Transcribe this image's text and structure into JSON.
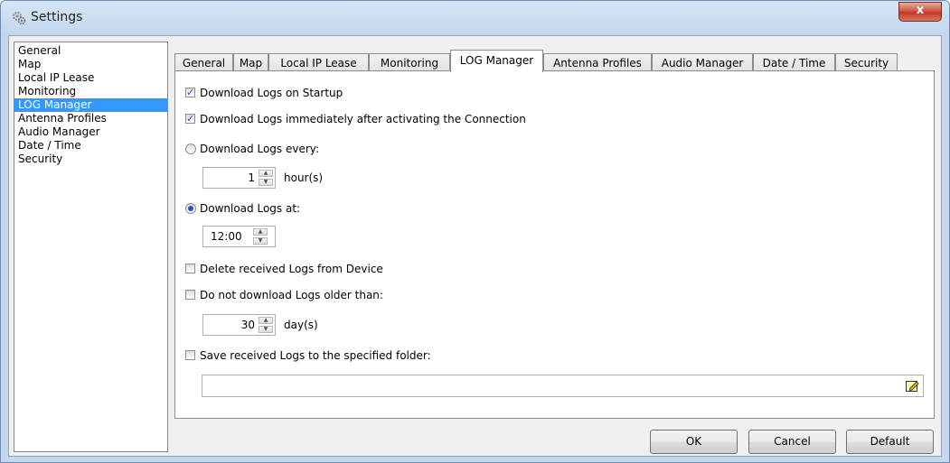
{
  "window": {
    "title": "Settings",
    "close_label": "x"
  },
  "sidebar": {
    "items": [
      {
        "label": "General"
      },
      {
        "label": "Map"
      },
      {
        "label": "Local IP Lease"
      },
      {
        "label": "Monitoring"
      },
      {
        "label": "LOG Manager",
        "selected": true
      },
      {
        "label": "Antenna Profiles"
      },
      {
        "label": "Audio Manager"
      },
      {
        "label": "Date / Time"
      },
      {
        "label": "Security"
      }
    ]
  },
  "tabs": [
    {
      "label": "General"
    },
    {
      "label": "Map"
    },
    {
      "label": "Local IP Lease"
    },
    {
      "label": "Monitoring"
    },
    {
      "label": "LOG Manager",
      "active": true
    },
    {
      "label": "Antenna Profiles"
    },
    {
      "label": "Audio Manager"
    },
    {
      "label": "Date / Time"
    },
    {
      "label": "Security"
    }
  ],
  "log_manager": {
    "download_on_startup": {
      "label": "Download Logs on Startup",
      "checked": true
    },
    "download_after_connect": {
      "label": "Download Logs immediately after activating the Connection",
      "checked": true
    },
    "download_every": {
      "label": "Download Logs every:",
      "selected": false,
      "value": "1",
      "unit": "hour(s)"
    },
    "download_at": {
      "label": "Download Logs at:",
      "selected": true,
      "value": "12:00"
    },
    "delete_received": {
      "label": "Delete received Logs from Device",
      "checked": false
    },
    "not_older_than": {
      "label": "Do not download Logs older than:",
      "checked": false,
      "value": "30",
      "unit": "day(s)"
    },
    "save_to_folder": {
      "label": "Save received Logs to the specified folder:",
      "checked": false,
      "path": ""
    }
  },
  "buttons": {
    "ok": "OK",
    "cancel": "Cancel",
    "default": "Default"
  },
  "colors": {
    "selection": "#3399ff",
    "title_bar": "#c4d7ee",
    "close_button": "#c0392b"
  }
}
